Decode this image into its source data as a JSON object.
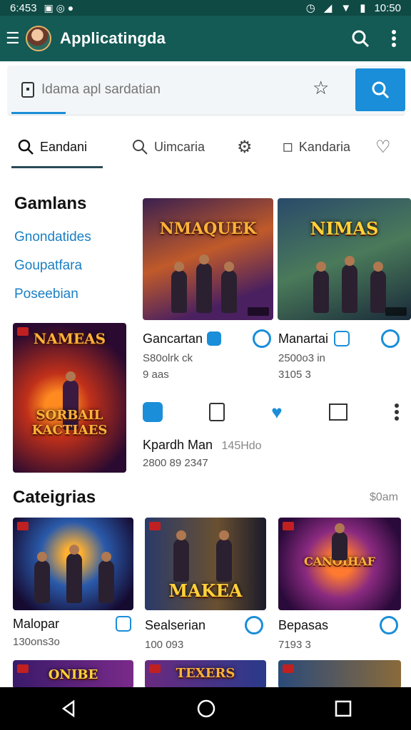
{
  "status_bar": {
    "time_left": "6:453",
    "time_right": "10:50"
  },
  "app_bar": {
    "title": "Applicatingda"
  },
  "search": {
    "placeholder": "Idama apl sardatian"
  },
  "tabs": [
    {
      "label": "Eandani",
      "icon": "search-icon"
    },
    {
      "label": "Uimcaria",
      "icon": "search-icon"
    },
    {
      "label": "",
      "icon": "gear-icon"
    },
    {
      "label": "Kandaria",
      "icon": "tag-icon"
    },
    {
      "label": "",
      "icon": "heart-icon"
    }
  ],
  "sidebar": {
    "title": "Gamlans",
    "links": [
      "Gnondatides",
      "Goupatfara",
      "Poseebian"
    ]
  },
  "featured": [
    {
      "art_title": "NMAQUEK",
      "name": "Gancartan",
      "sub1": "S80olrk ck",
      "sub2": "9 aas"
    },
    {
      "art_title": "NIMAS",
      "name": "Manartai",
      "sub1": "2500o3 in",
      "sub2": "3105 3"
    }
  ],
  "side_art": {
    "art_title": "NAMEAS",
    "art_subtitle": "SORBAIL KACTIAES"
  },
  "action_item": {
    "name": "Kpardh Man",
    "extra": "145Hdo",
    "sub": "2800 89 2347"
  },
  "categories": {
    "title": "Cateigrias",
    "more": "$0am",
    "items": [
      {
        "name": "Malopar",
        "sub": "130ons3o",
        "art_title": ""
      },
      {
        "name": "Sealserian",
        "sub": "100 093",
        "art_title": "MAKEA"
      },
      {
        "name": "Bepasas",
        "sub": "7193 3",
        "art_title": "CANOIHAF"
      }
    ]
  },
  "bottom_row": {
    "art_titles": [
      "ONIBE",
      "TEXERS",
      ""
    ]
  },
  "colors": {
    "appbar": "#145a55",
    "accent": "#1a8ed8",
    "link": "#1a7fc4"
  }
}
